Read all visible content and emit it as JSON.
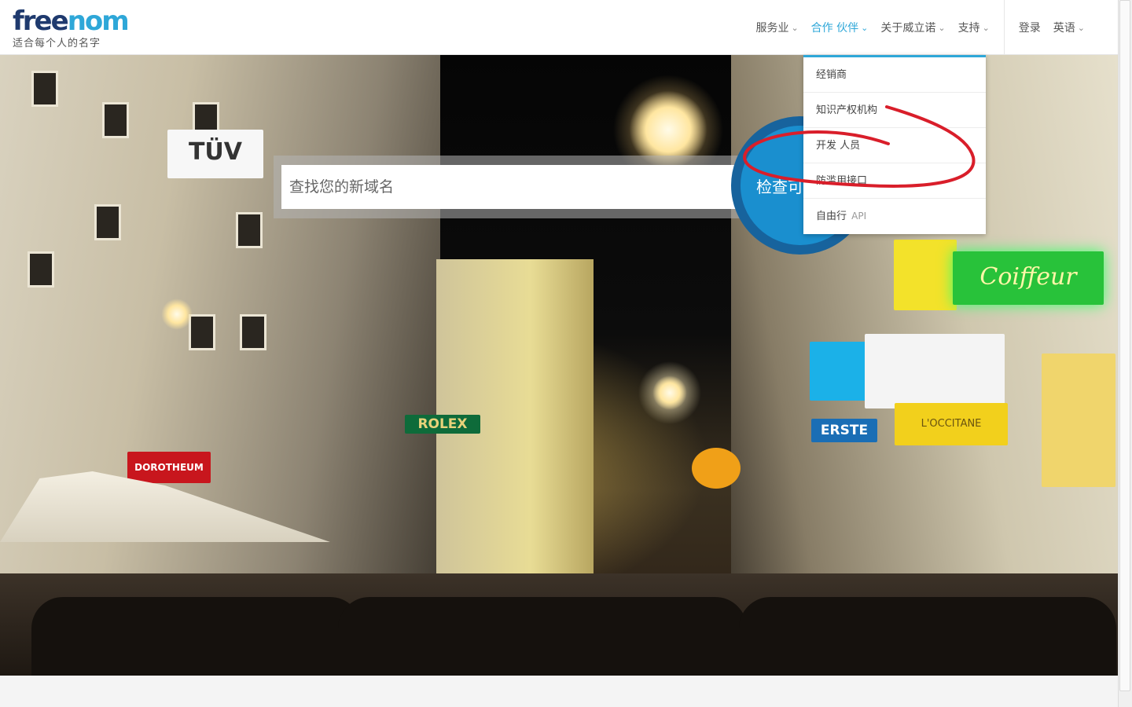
{
  "header": {
    "logo_word_a": "free",
    "logo_word_b": "nom",
    "tagline": "适合每个人的名字"
  },
  "nav": {
    "items": [
      {
        "label": "服务业",
        "active": false
      },
      {
        "label": "合作 伙伴",
        "active": true
      },
      {
        "label": "关于威立诺",
        "active": false
      },
      {
        "label": "支持",
        "active": false
      }
    ],
    "login": "登录",
    "language": "英语"
  },
  "search": {
    "placeholder": "查找您的新域名",
    "button_label": "检查可"
  },
  "partners_menu": {
    "items": [
      {
        "label": "经销商"
      },
      {
        "label": "知识产权机构"
      },
      {
        "label": "开发 人员"
      },
      {
        "label": "防滥用接口"
      },
      {
        "label": "自由行",
        "suffix": "API"
      }
    ]
  },
  "hero_signs": {
    "tuv": "TÜV",
    "dorotheum": "DOROTHEUM",
    "rolex": "ROLEX",
    "coiffeur": "Coiffeur",
    "erste": "ERSTE",
    "loccitane": "L'OCCITANE"
  },
  "colors": {
    "brand_dark": "#1f3a6e",
    "brand_accent": "#2ea7d8",
    "check_button": "#1a8fcf",
    "annotation_red": "#d91e2a"
  },
  "icons": {
    "chevron": "chevron-down-icon"
  }
}
